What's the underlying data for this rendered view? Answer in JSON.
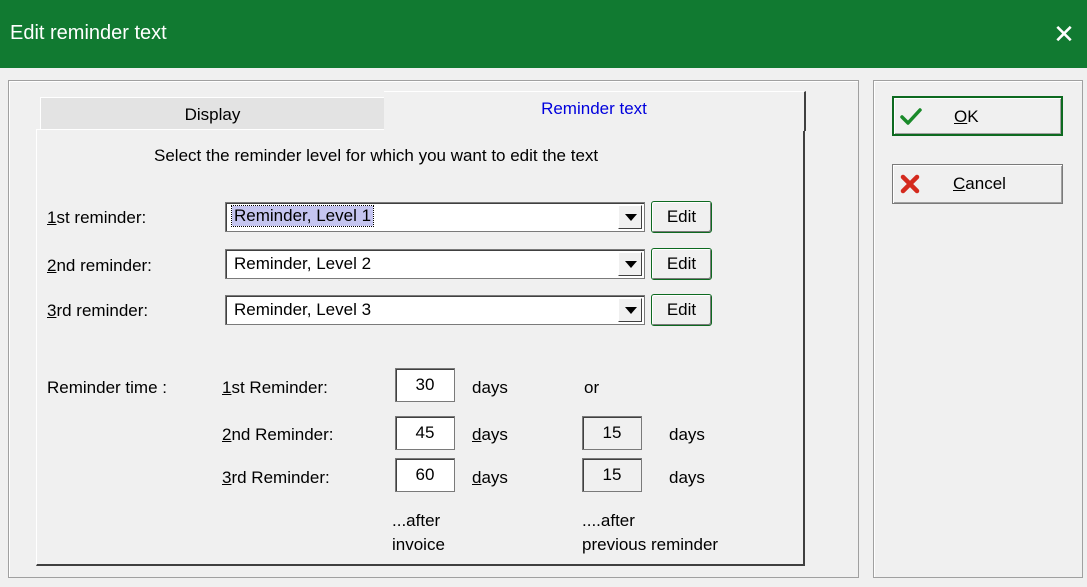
{
  "window": {
    "title": "Edit reminder text",
    "close_glyph": "✕"
  },
  "tabs": [
    {
      "label": "Display",
      "active": false
    },
    {
      "label": "Reminder text",
      "active": true
    }
  ],
  "instruction": "Select the reminder level for which you want to edit the text",
  "reminders": [
    {
      "key": "1",
      "label_rest": "st reminder:",
      "value": "Reminder, Level 1",
      "edit_label": "Edit",
      "focused": true
    },
    {
      "key": "2",
      "label_rest": "nd reminder:",
      "value": "Reminder, Level 2",
      "edit_label": "Edit",
      "focused": false
    },
    {
      "key": "3",
      "label_rest": "rd reminder:",
      "value": "Reminder, Level 3",
      "edit_label": "Edit",
      "focused": false
    }
  ],
  "reminder_time": {
    "label": "Reminder time :",
    "rows": [
      {
        "key": "1",
        "label_rest": "st Reminder:",
        "days_after_invoice": "30",
        "days_label": "days",
        "or_text": "or",
        "days_after_previous": null
      },
      {
        "key": "2",
        "label_rest": "nd Reminder:",
        "days_after_invoice": "45",
        "days_label_key": "d",
        "days_label_rest": "ays",
        "days_after_previous": "15",
        "days_label2": "days"
      },
      {
        "key": "3",
        "label_rest": "rd Reminder:",
        "days_after_invoice": "60",
        "days_label_key": "d",
        "days_label_rest": "ays",
        "days_after_previous": "15",
        "days_label2": "days"
      }
    ],
    "footer_after_invoice_1": "...after",
    "footer_after_invoice_2": "invoice",
    "footer_after_previous_1": "....after",
    "footer_after_previous_2": "previous reminder"
  },
  "buttons": {
    "ok": {
      "key": "O",
      "rest": "K",
      "icon": "checkmark-icon",
      "color": "#1a8a2a"
    },
    "cancel": {
      "key": "C",
      "rest": "ancel",
      "icon": "red-x-icon",
      "color": "#d42a1e"
    }
  },
  "colors": {
    "titlebar": "#117a31",
    "accent_tab_text": "#0000dd",
    "selection": "#c5c5f0"
  }
}
